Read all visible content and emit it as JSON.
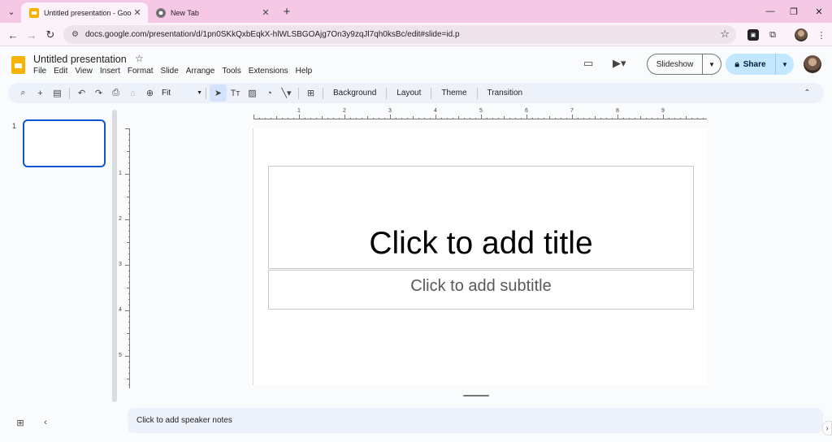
{
  "browser": {
    "tabs": [
      {
        "title": "Untitled presentation - Google",
        "active": true,
        "favicon": "slides-icon"
      },
      {
        "title": "New Tab",
        "active": false,
        "favicon": "chrome-icon"
      }
    ],
    "url": "docs.google.com/presentation/d/1pn0SKkQxbEqkX-hlWLSBGOAjg7On3y9zqJl7qh0ksBc/edit#slide=id.p",
    "new_tab_symbol": "+",
    "close_symbol": "✕",
    "minimize_symbol": "—",
    "restore_symbol": "❐",
    "window_close_symbol": "✕"
  },
  "app": {
    "title": "Untitled presentation",
    "menu": [
      "File",
      "Edit",
      "View",
      "Insert",
      "Format",
      "Slide",
      "Arrange",
      "Tools",
      "Extensions",
      "Help"
    ],
    "slideshow_label": "Slideshow",
    "share_label": "Share"
  },
  "toolbar": {
    "zoom": "Fit",
    "background_label": "Background",
    "layout_label": "Layout",
    "theme_label": "Theme",
    "transition_label": "Transition"
  },
  "filmstrip": {
    "slide_numbers": [
      "1"
    ]
  },
  "ruler": {
    "horizontal": [
      "1",
      "2",
      "3",
      "4",
      "5",
      "6",
      "7",
      "8",
      "9"
    ],
    "vertical": [
      "1",
      "2",
      "3",
      "4",
      "5"
    ]
  },
  "slide": {
    "title_placeholder": "Click to add title",
    "subtitle_placeholder": "Click to add subtitle"
  },
  "notes": {
    "placeholder": "Click to add speaker notes"
  },
  "colors": {
    "accent": "#0b57d0",
    "share_bg": "#c2e7ff",
    "tabbar_bg": "#f5c9e6",
    "logo": "#f6b400"
  }
}
